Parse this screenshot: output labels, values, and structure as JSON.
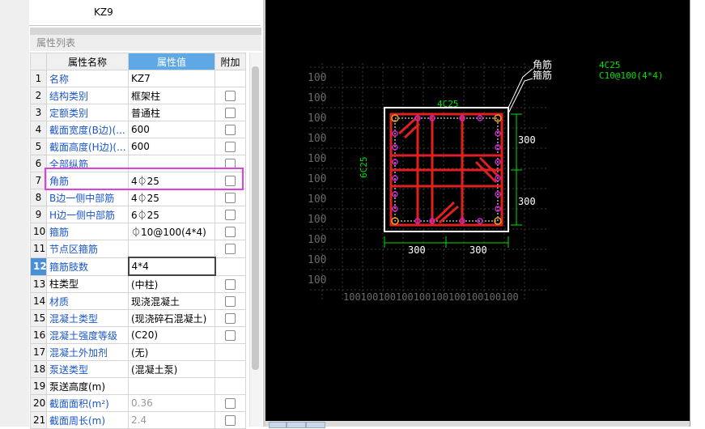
{
  "component": {
    "name": "KZ9"
  },
  "panel": {
    "title": "属性列表"
  },
  "table": {
    "headers": {
      "num": "",
      "name": "属性名称",
      "value": "属性值",
      "extra": "附加"
    },
    "rows": [
      {
        "num": "1",
        "name": "名称",
        "value": "KZ7",
        "check": false,
        "name_link": true
      },
      {
        "num": "2",
        "name": "结构类别",
        "value": "框架柱",
        "check": true,
        "name_link": true
      },
      {
        "num": "3",
        "name": "定额类别",
        "value": "普通柱",
        "check": true,
        "name_link": true
      },
      {
        "num": "4",
        "name": "截面宽度(B边)(...",
        "value": "600",
        "check": true,
        "name_link": true
      },
      {
        "num": "5",
        "name": "截面高度(H边)(...",
        "value": "600",
        "check": true,
        "name_link": true
      },
      {
        "num": "6",
        "name": "全部纵筋",
        "value": "",
        "check": true,
        "name_link": true
      },
      {
        "num": "7",
        "name": "角筋",
        "value": "4⏀25",
        "check": true,
        "name_link": true
      },
      {
        "num": "8",
        "name": "B边一侧中部筋",
        "value": "4⏀25",
        "check": true,
        "name_link": true
      },
      {
        "num": "9",
        "name": "H边一侧中部筋",
        "value": "6⏀25",
        "check": true,
        "name_link": true
      },
      {
        "num": "10",
        "name": "箍筋",
        "value": "⏀10@100(4*4)",
        "check": true,
        "name_link": true
      },
      {
        "num": "11",
        "name": "节点区箍筋",
        "value": "",
        "check": true,
        "name_link": true
      },
      {
        "num": "12",
        "name": "箍筋肢数",
        "value": "4*4",
        "check": false,
        "name_link": true
      },
      {
        "num": "13",
        "name": "柱类型",
        "value": "(中柱)",
        "check": true,
        "name_link": false
      },
      {
        "num": "14",
        "name": "材质",
        "value": "现浇混凝土",
        "check": true,
        "name_link": true
      },
      {
        "num": "15",
        "name": "混凝土类型",
        "value": "(现浇碎石混凝土)",
        "check": true,
        "name_link": true
      },
      {
        "num": "16",
        "name": "混凝土强度等级",
        "value": "(C20)",
        "check": true,
        "name_link": true
      },
      {
        "num": "17",
        "name": "混凝土外加剂",
        "value": "(无)",
        "check": false,
        "name_link": true
      },
      {
        "num": "18",
        "name": "泵送类型",
        "value": "(混凝土泵)",
        "check": false,
        "name_link": true
      },
      {
        "num": "19",
        "name": "泵送高度(m)",
        "value": "",
        "check": false,
        "name_link": false
      },
      {
        "num": "20",
        "name": "截面面积(m²)",
        "value": "0.36",
        "check": true,
        "name_link": true
      },
      {
        "num": "21",
        "name": "截面周长(m)",
        "value": "2.4",
        "check": true,
        "name_link": true
      }
    ]
  },
  "drawing": {
    "legend_corner": "角筋",
    "legend_stirrup": "箍筋",
    "corner_spec": "4C25",
    "stirrup_spec": "C10@100(4*4)",
    "top_bar_label": "4C25",
    "side_bar_label": "6C25",
    "dim_right_top": "300",
    "dim_right_bottom": "300",
    "dim_bottom_left": "300",
    "dim_bottom_right": "300",
    "grid_label": "100",
    "bottom_scale": "100100100100100100100100100100"
  },
  "colors": {
    "accent": "#5fa8e6",
    "highlight": "#e040e0",
    "rebar": "#e02020",
    "dim": "#00e000",
    "canvas": "#000000"
  }
}
